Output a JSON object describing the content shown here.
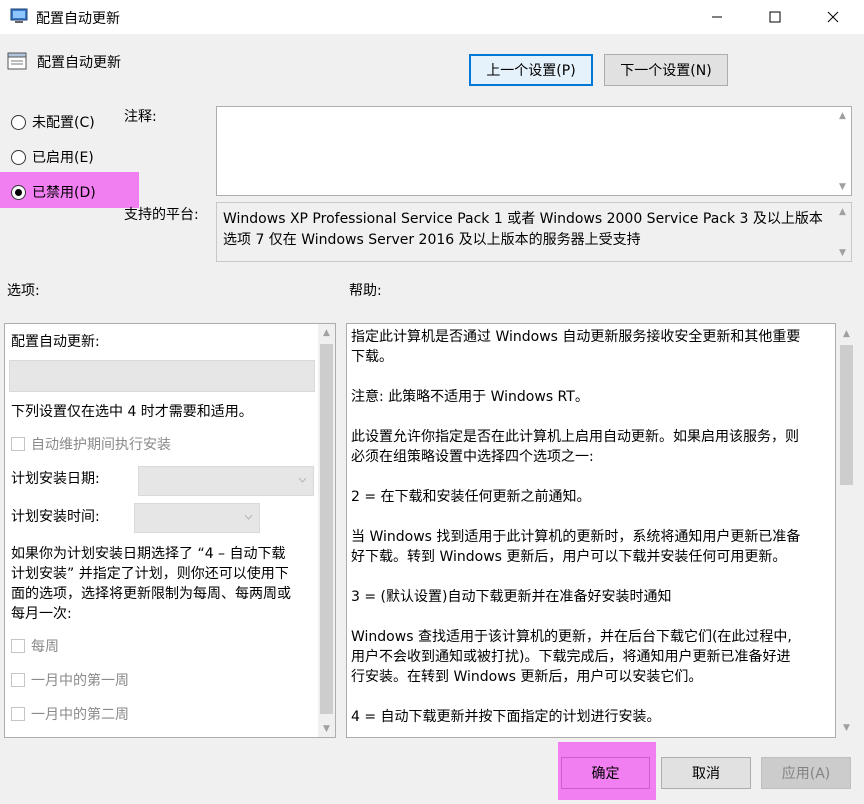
{
  "window": {
    "title": "配置自动更新",
    "controls": [
      "minimize-icon",
      "maximize-icon",
      "close-icon"
    ]
  },
  "header": {
    "policy_name": "配置自动更新",
    "prev_button": "上一个设置(P)",
    "next_button": "下一个设置(N)"
  },
  "state_options": [
    {
      "label": "未配置(C)",
      "checked": false
    },
    {
      "label": "已启用(E)",
      "checked": false
    },
    {
      "label": "已禁用(D)",
      "checked": true
    }
  ],
  "comment": {
    "label": "注释:",
    "value": ""
  },
  "supported": {
    "label": "支持的平台:",
    "lines": [
      "Windows XP Professional Service Pack 1 或者 Windows 2000 Service Pack 3 及以上版本",
      "选项 7 仅在 Windows Server 2016 及以上版本的服务器上受支持"
    ]
  },
  "options_section": {
    "heading": "选项:",
    "configure_label": "配置自动更新:",
    "note": "下列设置仅在选中 4 时才需要和适用。",
    "maintenance_check": "自动维护期间执行安装",
    "schedule_day_label": "计划安装日期:",
    "schedule_time_label": "计划安装时间:",
    "schedule_desc_lines": [
      "如果你为计划安装日期选择了 “4 – 自动下载",
      "计划安装” 并指定了计划，则你还可以使用下",
      "面的选项，选择将更新限制为每周、每两周或",
      "每月一次:"
    ],
    "week_checks": [
      "每周",
      "一月中的第一周",
      "一月中的第二周"
    ]
  },
  "help_section": {
    "heading": "帮助:",
    "paragraphs": [
      [
        "指定此计算机是否通过 Windows 自动更新服务接收安全更新和其他重要",
        "下载。"
      ],
      [
        "注意: 此策略不适用于 Windows RT。"
      ],
      [
        "此设置允许你指定是否在此计算机上启用自动更新。如果启用该服务，则",
        "必须在组策略设置中选择四个选项之一:"
      ],
      [
        " 2 = 在下载和安装任何更新之前通知。"
      ],
      [
        " 当 Windows 找到适用于此计算机的更新时，系统将通知用户更新已准备",
        "好下载。转到 Windows 更新后，用户可以下载并安装任何可用更新。"
      ],
      [
        " 3 = (默认设置)自动下载更新并在准备好安装时通知"
      ],
      [
        " Windows 查找适用于该计算机的更新，并在后台下载它们(在此过程中,",
        "用户不会收到通知或被打扰)。下载完成后，将通知用户更新已准备好进",
        "行安装。在转到 Windows 更新后，用户可以安装它们。"
      ],
      [
        " 4 = 自动下载更新并按下面指定的计划进行安装。"
      ]
    ]
  },
  "footer": {
    "ok": "确定",
    "cancel": "取消",
    "apply": "应用(A)"
  },
  "colors": {
    "highlight": "#f27ff2",
    "focus_border": "#0078d7"
  }
}
